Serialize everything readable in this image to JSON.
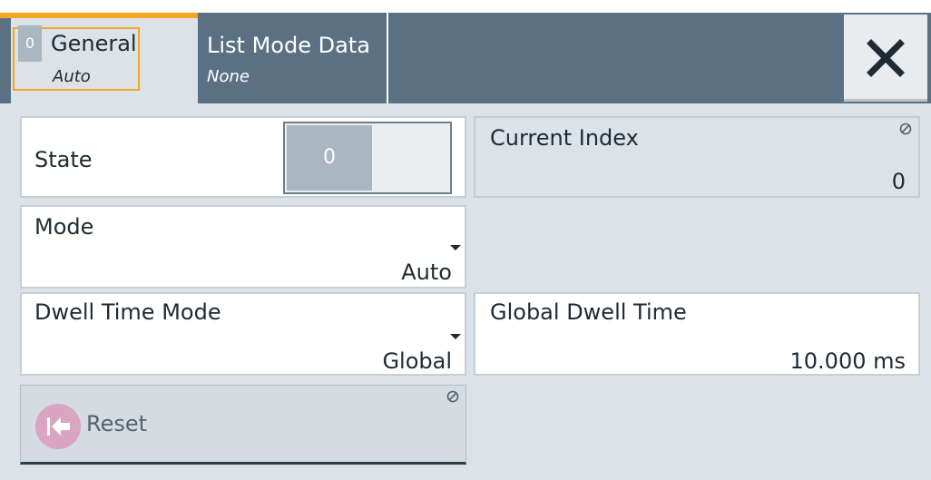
{
  "tabs": [
    {
      "title": "General",
      "subtitle": "Auto",
      "toggle_value": "0",
      "active": true
    },
    {
      "title": "List Mode Data",
      "subtitle": "None",
      "active": false
    }
  ],
  "close_icon": "close-icon",
  "state": {
    "label": "State",
    "toggle_value": "0"
  },
  "current_index": {
    "label": "Current Index",
    "value": "0"
  },
  "mode": {
    "label": "Mode",
    "value": "Auto"
  },
  "dwell_time_mode": {
    "label": "Dwell Time Mode",
    "value": "Global"
  },
  "global_dwell_time": {
    "label": "Global Dwell Time",
    "value": "10.000 ms"
  },
  "reset": {
    "label": "Reset",
    "icon": "reset-icon"
  },
  "colors": {
    "accent": "#f5a623",
    "tabbar": "#5b7183",
    "background": "#dbe2e8"
  }
}
